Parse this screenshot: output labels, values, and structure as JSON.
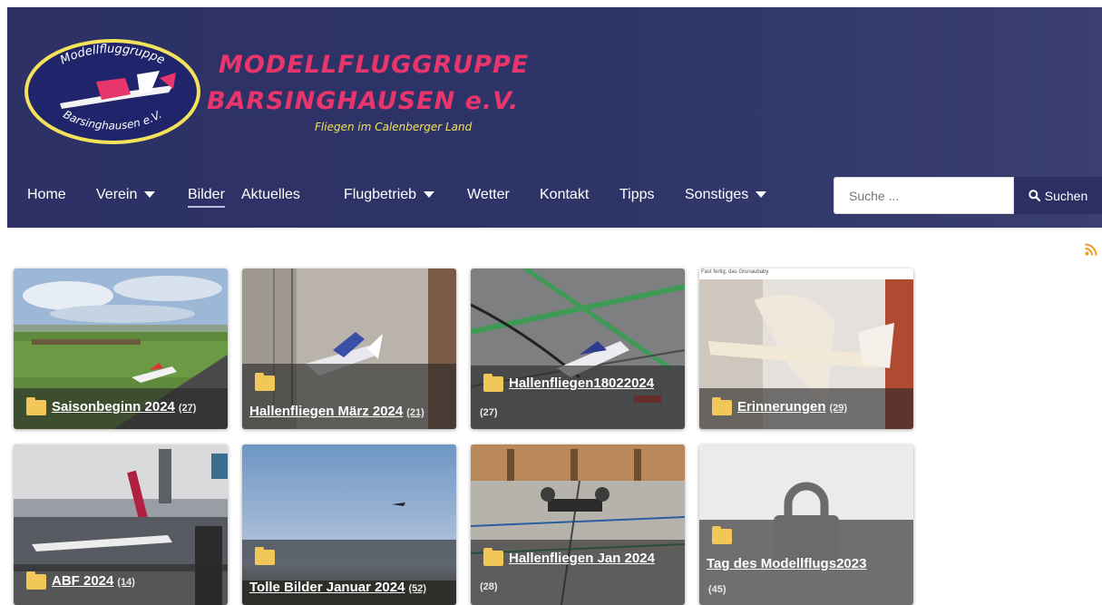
{
  "brand": {
    "emblem_top": "Modellfluggruppe",
    "emblem_bottom": "Barsinghausen e.V.",
    "line1": "MODELLFLUGGRUPPE",
    "line2": "BARSINGHAUSEN e.V.",
    "tagline": "Fliegen im Calenberger Land"
  },
  "nav": {
    "items": [
      {
        "label": "Home",
        "dropdown": false,
        "active": false
      },
      {
        "label": "Verein",
        "dropdown": true,
        "active": false
      },
      {
        "label": "Bilder",
        "dropdown": false,
        "active": true
      },
      {
        "label": "Aktuelles",
        "dropdown": false,
        "active": false
      },
      {
        "label": "Flugbetrieb",
        "dropdown": true,
        "active": false
      },
      {
        "label": "Wetter",
        "dropdown": false,
        "active": false
      },
      {
        "label": "Kontakt",
        "dropdown": false,
        "active": false
      },
      {
        "label": "Tipps",
        "dropdown": false,
        "active": false
      },
      {
        "label": "Sonstiges",
        "dropdown": true,
        "active": false
      }
    ]
  },
  "search": {
    "placeholder": "Suche ...",
    "button_label": "Suchen",
    "icon": "search-icon"
  },
  "rss_icon": "rss-icon",
  "gallery": {
    "albums": [
      {
        "title": "Saisonbeginn 2024",
        "count": "(27)",
        "theme": "field"
      },
      {
        "title": "Hallenfliegen März 2024",
        "count": "(21)",
        "theme": "hall-wall"
      },
      {
        "title": "Hallenfliegen18022024",
        "count": "(27)",
        "theme": "hall-floor"
      },
      {
        "title": "Erinnerungen",
        "count": "(29)",
        "theme": "workshop",
        "caption": "Fast fertig, das Grunaubaby"
      },
      {
        "title": "ABF 2024",
        "count": "(14)",
        "theme": "fair"
      },
      {
        "title": "Tolle Bilder Januar 2024",
        "count": "(52)",
        "theme": "sky"
      },
      {
        "title": "Hallenfliegen Jan 2024",
        "count": "(28)",
        "theme": "drone"
      },
      {
        "title": "Tag des Modellflugs2023",
        "count": "(45)",
        "theme": "locked",
        "icon": "lock-icon"
      }
    ]
  },
  "colors": {
    "header_bg": "#2d3165",
    "brand_pink": "#e8356b",
    "tagline_yellow": "#f3e25a",
    "folder_yellow": "#f2c75a",
    "rss_orange": "#f29a1d"
  }
}
